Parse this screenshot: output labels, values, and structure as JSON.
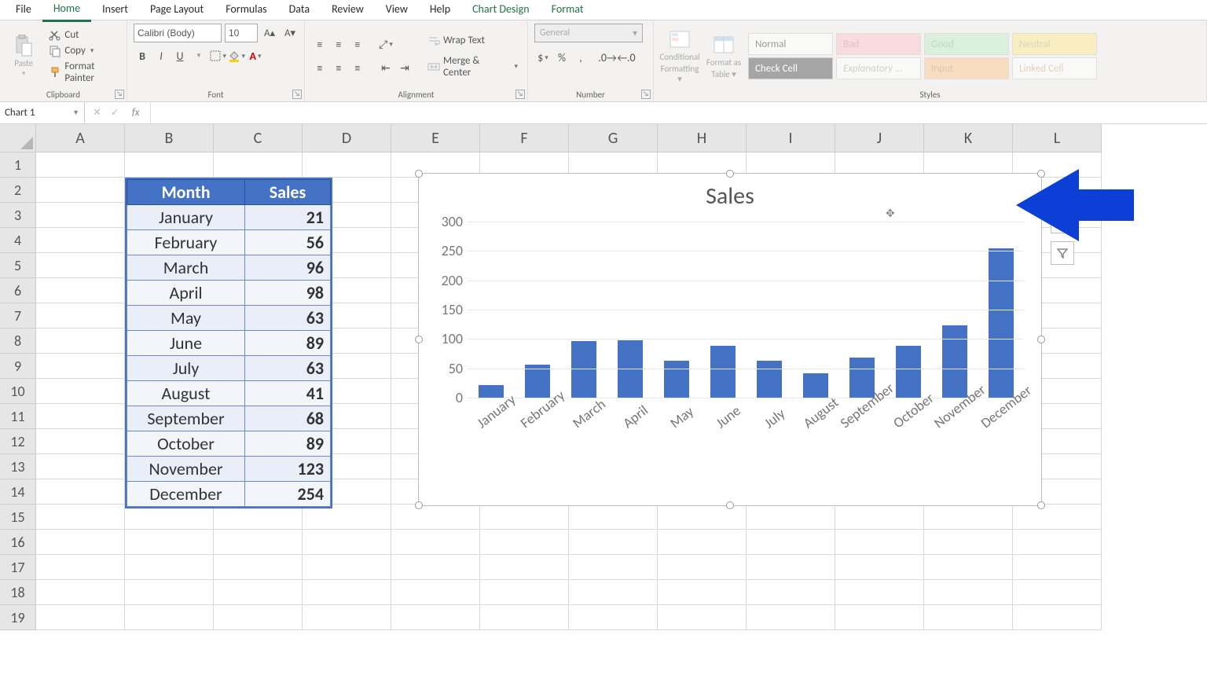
{
  "tabs": [
    "File",
    "Home",
    "Insert",
    "Page Layout",
    "Formulas",
    "Data",
    "Review",
    "View",
    "Help",
    "Chart Design",
    "Format"
  ],
  "active_tab": "Home",
  "ribbon": {
    "clipboard": {
      "paste": "Paste",
      "cut": "Cut",
      "copy": "Copy",
      "painter": "Format Painter",
      "label": "Clipboard"
    },
    "font": {
      "name": "Calibri (Body)",
      "size": "10",
      "label": "Font"
    },
    "alignment": {
      "wrap": "Wrap Text",
      "merge": "Merge & Center",
      "label": "Alignment"
    },
    "number": {
      "format": "General",
      "label": "Number"
    },
    "cond": {
      "l1": "Conditional",
      "l2": "Formatting"
    },
    "fmt_table": {
      "l1": "Format as",
      "l2": "Table"
    },
    "styles": {
      "normal": "Normal",
      "bad": "Bad",
      "good": "Good",
      "neutral": "Neutral",
      "check": "Check Cell",
      "explan": "Explanatory ...",
      "input": "Input",
      "linked": "Linked Cell",
      "label": "Styles"
    }
  },
  "name_box": "Chart 1",
  "columns": [
    "A",
    "B",
    "C",
    "D",
    "E",
    "F",
    "G",
    "H",
    "I",
    "J",
    "K",
    "L"
  ],
  "rows": [
    "1",
    "2",
    "3",
    "4",
    "5",
    "6",
    "7",
    "8",
    "9",
    "10",
    "11",
    "12",
    "13",
    "14",
    "15",
    "16",
    "17",
    "18",
    "19"
  ],
  "table": {
    "head_month": "Month",
    "head_sales": "Sales",
    "rows": [
      {
        "m": "January",
        "v": "21"
      },
      {
        "m": "February",
        "v": "56"
      },
      {
        "m": "March",
        "v": "96"
      },
      {
        "m": "April",
        "v": "98"
      },
      {
        "m": "May",
        "v": "63"
      },
      {
        "m": "June",
        "v": "89"
      },
      {
        "m": "July",
        "v": "63"
      },
      {
        "m": "August",
        "v": "41"
      },
      {
        "m": "September",
        "v": "68"
      },
      {
        "m": "October",
        "v": "89"
      },
      {
        "m": "November",
        "v": "123"
      },
      {
        "m": "December",
        "v": "254"
      }
    ]
  },
  "chart_data": {
    "type": "bar",
    "title": "Sales",
    "categories": [
      "January",
      "February",
      "March",
      "April",
      "May",
      "June",
      "July",
      "August",
      "September",
      "October",
      "November",
      "December"
    ],
    "values": [
      21,
      56,
      96,
      98,
      63,
      89,
      63,
      41,
      68,
      89,
      123,
      254
    ],
    "xlabel": "",
    "ylabel": "",
    "ylim": [
      0,
      300
    ],
    "y_ticks": [
      0,
      50,
      100,
      150,
      200,
      250,
      300
    ]
  }
}
